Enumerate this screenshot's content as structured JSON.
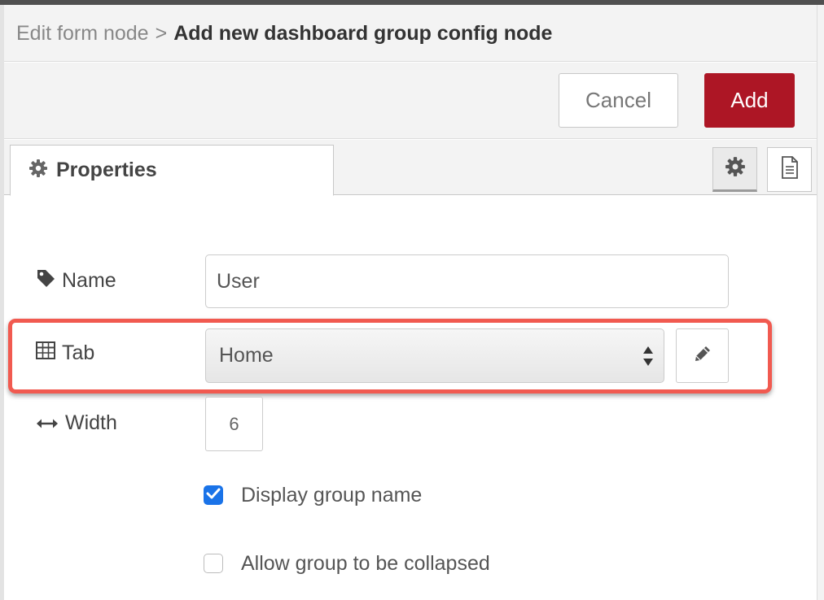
{
  "breadcrumb": {
    "parent": "Edit form node",
    "separator": ">",
    "current": "Add new dashboard group config node"
  },
  "toolbar": {
    "cancel_label": "Cancel",
    "add_label": "Add"
  },
  "tabs": {
    "properties_label": "Properties"
  },
  "form": {
    "name": {
      "label": "Name",
      "value": "User"
    },
    "tab": {
      "label": "Tab",
      "selected": "Home"
    },
    "width": {
      "label": "Width",
      "value": "6"
    },
    "display_group_name": {
      "label": "Display group name",
      "checked": true
    },
    "allow_collapse": {
      "label": "Allow group to be collapsed",
      "checked": false
    }
  },
  "colors": {
    "add_button": "#ad1625",
    "highlight": "#f15a50",
    "checkbox_checked": "#1a73e8"
  },
  "icons": [
    "cog-icon",
    "info-book-icon",
    "tag-icon",
    "table-icon",
    "arrows-h-icon",
    "pencil-icon",
    "sort-arrows-icon",
    "check-icon"
  ]
}
